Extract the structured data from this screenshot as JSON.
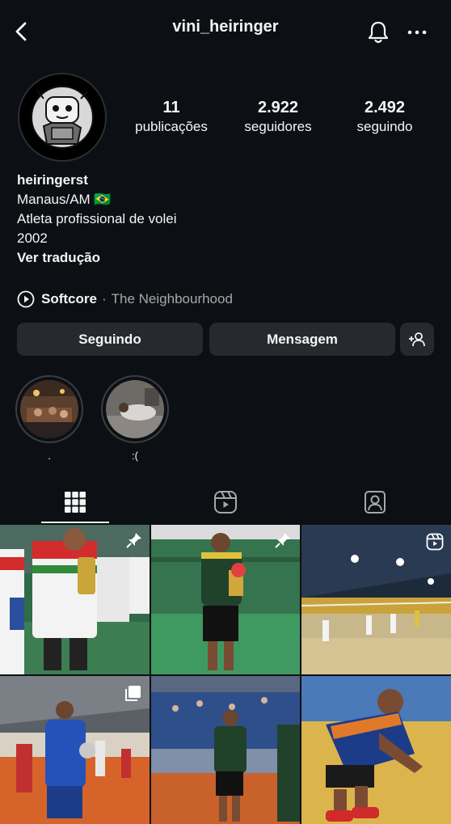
{
  "header": {
    "username": "vini_heiringer",
    "back_icon": "chevron-left-icon",
    "notify_icon": "bell-icon",
    "more_icon": "more-horizontal-icon"
  },
  "stats": [
    {
      "value": "11",
      "label": "publicações"
    },
    {
      "value": "2.922",
      "label": "seguidores"
    },
    {
      "value": "2.492",
      "label": "seguindo"
    }
  ],
  "bio": {
    "name": "heiringerst",
    "location": "Manaus/AM 🇧🇷",
    "description": "Atleta profissional de volei",
    "year": "2002",
    "translate": "Ver tradução"
  },
  "music": {
    "track": "Softcore",
    "separator": "·",
    "artist": "The Neighbourhood"
  },
  "actions": {
    "following": "Seguindo",
    "message": "Mensagem"
  },
  "highlights": [
    {
      "label": "."
    },
    {
      "label": ":("
    }
  ],
  "tabs": [
    "grid-icon",
    "reels-icon",
    "tagged-icon"
  ],
  "colors": {
    "background": "#0c1014",
    "button": "#262a2f",
    "text": "#f5f5f5",
    "muted": "#a8a8a8"
  }
}
